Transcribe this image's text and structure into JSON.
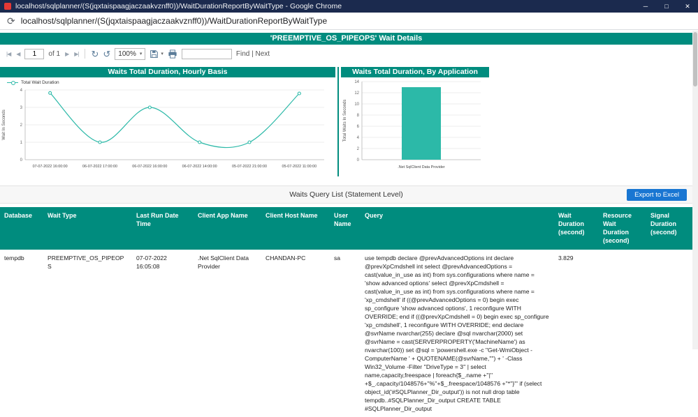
{
  "browser": {
    "window_title": "localhost/sqlplanner/(S(jqxtaispaagjaczaakvznff0))/WaitDurationReportByWaitType - Google Chrome",
    "url": "localhost/sqlplanner/(S(jqxtaispaagjaczaakvznff0))/WaitDurationReportByWaitType"
  },
  "icons": {
    "minimize": "─",
    "maximize": "□",
    "close": "✕",
    "reload": "⟳",
    "nav_first": "|◀",
    "nav_prev": "◀",
    "nav_next": "▶",
    "nav_last": "▶|",
    "refresh": "↻",
    "back": "↺",
    "caret": "▾"
  },
  "report": {
    "title": "'PREEMPTIVE_OS_PIPEOPS' Wait Details"
  },
  "toolbar": {
    "page_value": "1",
    "page_of": "of 1",
    "zoom": "100%",
    "find": "Find | Next"
  },
  "section": {
    "title": "Waits Query List (Statement Level)",
    "export_button": "Export to Excel"
  },
  "colors": {
    "accent": "#008C7E",
    "series": "#2CB9A8",
    "export_button": "#1976D2",
    "titlebar": "#1B2A4E"
  },
  "chart_data": [
    {
      "type": "line",
      "title": "Waits Total Duration, Hourly Basis",
      "legend": [
        "Total Wait Duration"
      ],
      "ylabel": "Wait In Seconds",
      "ylim": [
        0,
        4
      ],
      "yticks": [
        0,
        1,
        2,
        3,
        4
      ],
      "x": [
        "07-07-2022 16:00:00",
        "06-07-2022 17:00:00",
        "06-07-2022 16:00:00",
        "06-07-2022 14:00:00",
        "05-07-2022 21:00:00",
        "05-07-2022 11:00:00"
      ],
      "values": [
        3.829,
        1,
        3,
        1,
        1,
        3.8
      ],
      "grid": true,
      "color": "#2CB9A8"
    },
    {
      "type": "bar",
      "title": "Waits Total Duration, By Application",
      "ylabel": "Total Waits In Seconds",
      "ylim": [
        0,
        14
      ],
      "yticks": [
        0,
        2,
        4,
        6,
        8,
        10,
        12,
        14
      ],
      "categories": [
        ".Net SqlClient Data Provider"
      ],
      "values": [
        13
      ],
      "grid": true,
      "color": "#2CB9A8"
    }
  ],
  "table": {
    "columns": [
      "Database",
      "Wait Type",
      "Last Run Date Time",
      "Client App Name",
      "Client Host Name",
      "User Name",
      "Query",
      "Wait Duration (second)",
      "Resource Wait Duration (second)",
      "Signal Duration (second)"
    ],
    "rows": [
      {
        "database": "tempdb",
        "wait_type": "PREEMPTIVE_OS_PIPEOPS",
        "last_run_date_time": "07-07-2022 16:05:08",
        "client_app_name": ".Net SqlClient Data Provider",
        "client_host_name": "CHANDAN-PC",
        "user_name": "sa",
        "query": "use tempdb declare @prevAdvancedOptions int declare @prevXpCmdshell int select @prevAdvancedOptions = cast(value_in_use as int) from sys.configurations where name = 'show advanced options' select @prevXpCmdshell = cast(value_in_use as int) from sys.configurations where name = 'xp_cmdshell' if ((@prevAdvancedOptions = 0) begin exec sp_configure 'show advanced options', 1 reconfigure WITH OVERRIDE; end if ((@prevXpCmdshell = 0) begin exec sp_configure 'xp_cmdshell', 1 reconfigure WITH OVERRIDE; end declare @svrName nvarchar(255) declare @sql nvarchar(2000) set @svrName = cast(SERVERPROPERTY('MachineName') as nvarchar(100)) set @sql = 'powershell.exe -c \"Get-WmiObject -ComputerName ' + QUOTENAME(@svrName,'\"') + ' -Class Win32_Volume -Filter ''DriveType = 3'' | select name,capacity,freespace | foreach{$_.name +''|'' +$_.capacity/1048576+''%''+$_.freespace/1048576 +''*''}\"' if (select object_id('#SQLPlanner_Dir_output')) is not null drop table tempdb..#SQLPlanner_Dir_output CREATE TABLE #SQLPlanner_Dir_output",
        "wait_duration": "3.829",
        "resource_wait_duration": "",
        "signal_duration": ""
      }
    ]
  }
}
